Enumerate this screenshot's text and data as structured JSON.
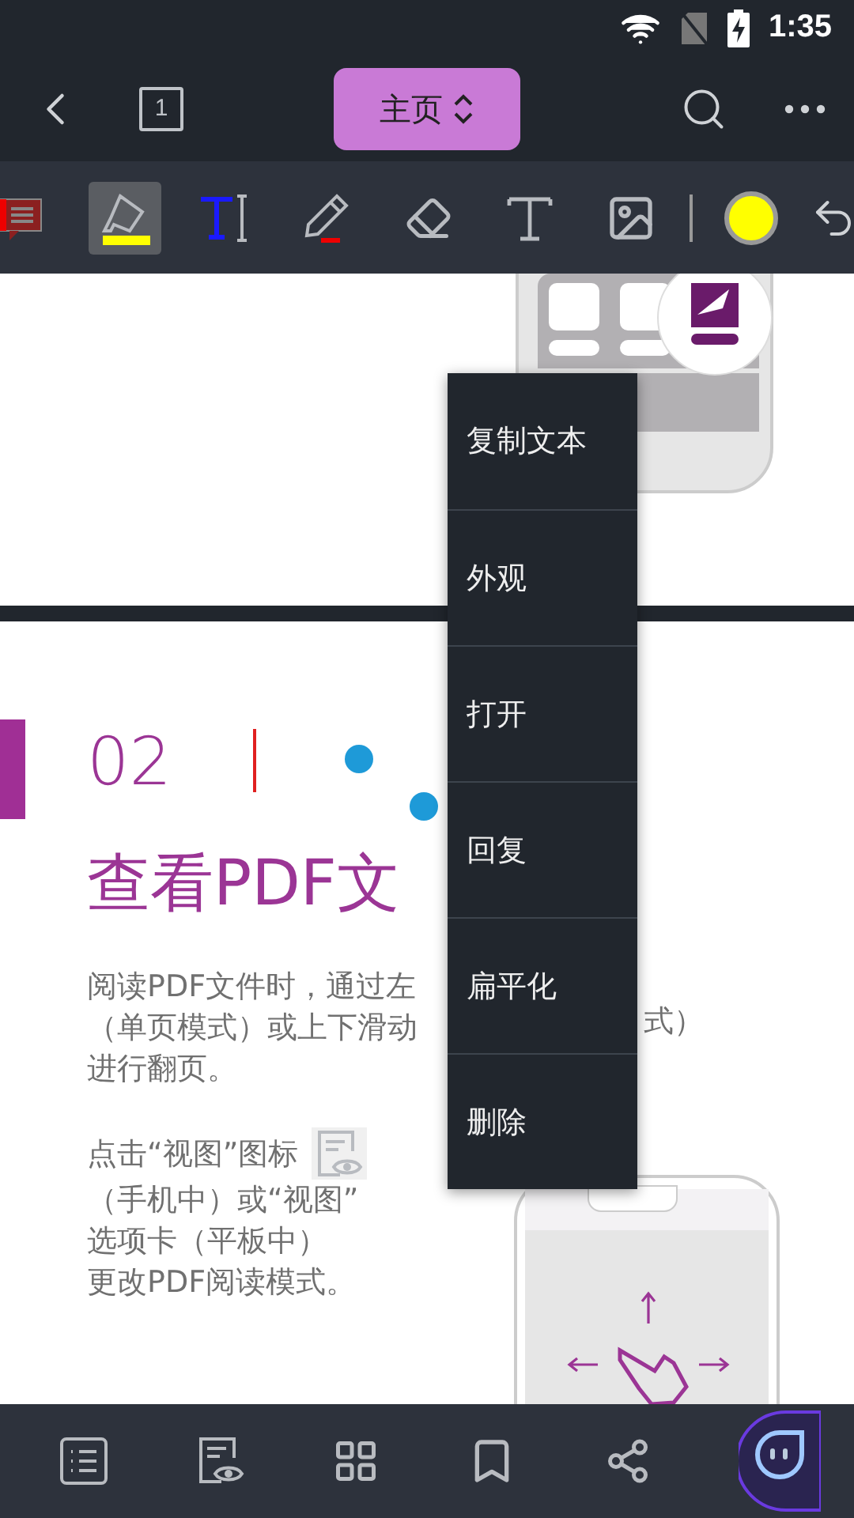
{
  "status_bar": {
    "time": "1:35"
  },
  "top_bar": {
    "page_number": "1",
    "title": "主页"
  },
  "toolbar": {
    "tools": [
      {
        "kind": "comment",
        "selected": false
      },
      {
        "kind": "highlight",
        "selected": true
      },
      {
        "kind": "insert_text",
        "selected": false
      },
      {
        "kind": "pencil",
        "selected": false
      },
      {
        "kind": "eraser",
        "selected": false
      },
      {
        "kind": "text",
        "selected": false
      },
      {
        "kind": "image",
        "selected": false
      }
    ],
    "color": "#ffff00"
  },
  "menu": {
    "items": [
      "复制文本",
      "外观",
      "打开",
      "回复",
      "扁平化",
      "删除"
    ]
  },
  "page_two": {
    "number": "02",
    "title": "查看PDF文",
    "paragraph_1": [
      "阅读PDF文件时，通过左",
      "（单页模式）或上下滑动",
      "进行翻页。"
    ],
    "fragment": "式）",
    "paragraph_2": [
      "点击“视图”图标",
      "（手机中）或“视图”",
      "选项卡（平板中）",
      "更改PDF阅读模式。"
    ]
  },
  "bottom_nav": {
    "items": [
      {
        "kind": "outline"
      },
      {
        "kind": "view"
      },
      {
        "kind": "thumbnails"
      },
      {
        "kind": "bookmark"
      },
      {
        "kind": "share"
      },
      {
        "kind": "assistant"
      }
    ]
  }
}
